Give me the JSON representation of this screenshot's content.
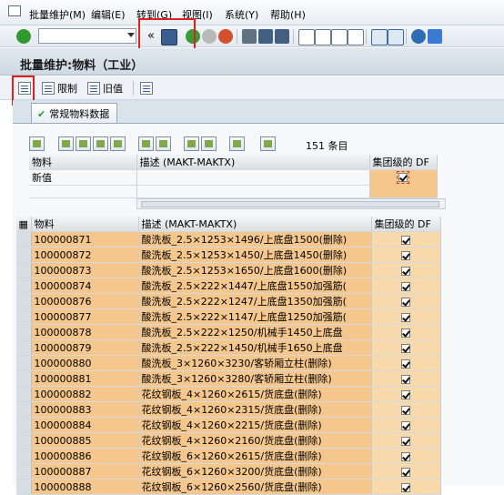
{
  "menu": [
    "批量维护(M)",
    "编辑(E)",
    "转到(G)",
    "视图(I)",
    "系统(Y)",
    "帮助(H)"
  ],
  "toolbar": {
    "back_arrows": "«"
  },
  "title": "批量维护:物料（工业）",
  "app_toolbar": {
    "restrict_label": "限制",
    "old_value_label": "旧值"
  },
  "tab": {
    "label": "常规物料数据"
  },
  "count_text": "151 条目",
  "upper_grid": {
    "headers": [
      "物料",
      "描述 (MAKT-MAKTX)",
      "集团级的 DF"
    ],
    "new_value_label": "新值"
  },
  "lower_grid": {
    "headers": [
      "物料",
      "描述 (MAKT-MAKTX)",
      "集团级的 DF"
    ],
    "rows": [
      {
        "material": "100000871",
        "desc": "酸洗板_2.5×1253×1496/上底盘1500(删除)",
        "df": true
      },
      {
        "material": "100000872",
        "desc": "酸洗板_2.5×1253×1450/上底盘1450(删除)",
        "df": true
      },
      {
        "material": "100000873",
        "desc": "酸洗板_2.5×1253×1650/上底盘1600(删除)",
        "df": true
      },
      {
        "material": "100000874",
        "desc": "酸洗板_2.5×222×1447/上底盘1550加强筋(",
        "df": true
      },
      {
        "material": "100000876",
        "desc": "酸洗板_2.5×222×1247/上底盘1350加强筋(",
        "df": true
      },
      {
        "material": "100000877",
        "desc": "酸洗板_2.5×222×1147/上底盘1250加强筋(",
        "df": true
      },
      {
        "material": "100000878",
        "desc": "酸洗板_2.5×222×1250/机械手1450上底盘",
        "df": true
      },
      {
        "material": "100000879",
        "desc": "酸洗板_2.5×222×1450/机械手1650上底盘",
        "df": true
      },
      {
        "material": "100000880",
        "desc": "酸洗板_3×1260×3230/客轿厢立柱(删除)",
        "df": true
      },
      {
        "material": "100000881",
        "desc": "酸洗板_3×1260×3280/客轿厢立柱(删除)",
        "df": true
      },
      {
        "material": "100000882",
        "desc": "花纹钢板_4×1260×2615/货底盘(删除)",
        "df": true
      },
      {
        "material": "100000883",
        "desc": "花纹钢板_4×1260×2315/货底盘(删除)",
        "df": true
      },
      {
        "material": "100000884",
        "desc": "花纹钢板_4×1260×2215/货底盘(删除)",
        "df": true
      },
      {
        "material": "100000885",
        "desc": "花纹钢板_4×1260×2160/货底盘(删除)",
        "df": true
      },
      {
        "material": "100000886",
        "desc": "花纹钢板_6×1260×2615/货底盘(删除)",
        "df": true
      },
      {
        "material": "100000887",
        "desc": "花纹钢板_6×1260×3200/货底盘(删除)",
        "df": true
      },
      {
        "material": "100000888",
        "desc": "花纹钢板_6×1260×2560/货底盘(删除)",
        "df": true
      }
    ]
  },
  "colors": {
    "highlight": "#f5c78d",
    "annotation_red": "#e12020"
  }
}
